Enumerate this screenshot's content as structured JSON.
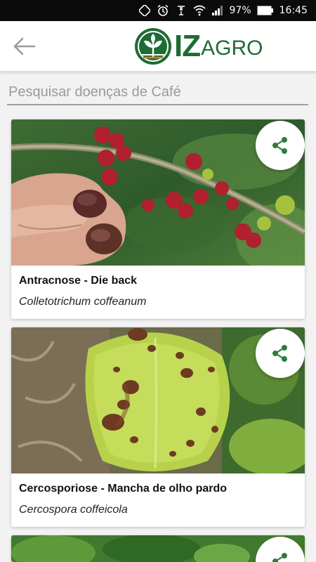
{
  "status_bar": {
    "battery": "97%",
    "time": "16:45",
    "icons": [
      "sync-icon",
      "alarm-icon",
      "vibrate-icon",
      "wifi-icon",
      "signal-icon",
      "battery-icon"
    ]
  },
  "header": {
    "back_icon": "arrow-left-icon",
    "logo_iz": "IZ",
    "logo_agro": "AGRO"
  },
  "search": {
    "placeholder": "Pesquisar doenças de Café"
  },
  "cards": [
    {
      "title": "Antracnose -  Die back",
      "subtitle": "Colletotrichum coffeanum",
      "share_icon": "share-icon"
    },
    {
      "title": "Cercosporiose -  Mancha de olho pardo",
      "subtitle": "Cercospora coffeicola",
      "share_icon": "share-icon"
    },
    {
      "title": "",
      "subtitle": "",
      "share_icon": "share-icon"
    }
  ],
  "colors": {
    "brand_green": "#1f6b35",
    "share_green": "#2e7d3a"
  }
}
